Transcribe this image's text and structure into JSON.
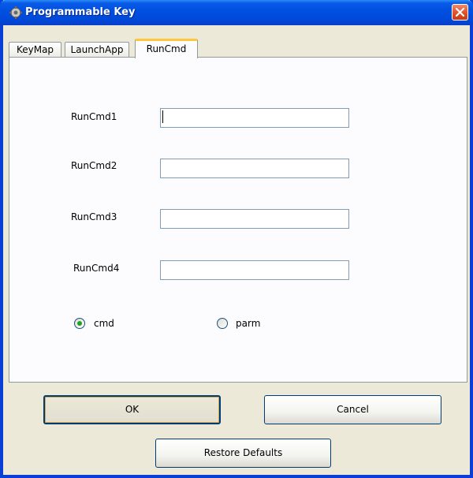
{
  "window": {
    "title": "Programmable Key"
  },
  "tabs": [
    {
      "label": "KeyMap",
      "active": false
    },
    {
      "label": "LaunchApp",
      "active": false
    },
    {
      "label": "RunCmd",
      "active": true
    }
  ],
  "form": {
    "fields": [
      {
        "label": "RunCmd1",
        "value": "",
        "focused": true
      },
      {
        "label": "RunCmd2",
        "value": ""
      },
      {
        "label": "RunCmd3",
        "value": ""
      },
      {
        "label": "RunCmd4",
        "value": ""
      }
    ],
    "radios": [
      {
        "label": "cmd",
        "checked": true
      },
      {
        "label": "parm",
        "checked": false
      }
    ]
  },
  "buttons": {
    "ok": "OK",
    "cancel": "Cancel",
    "restore": "Restore Defaults"
  },
  "colors": {
    "titlebar": "#0050e0",
    "radio_dot": "#21a121",
    "active_tab_accent": "#ffc83c"
  }
}
